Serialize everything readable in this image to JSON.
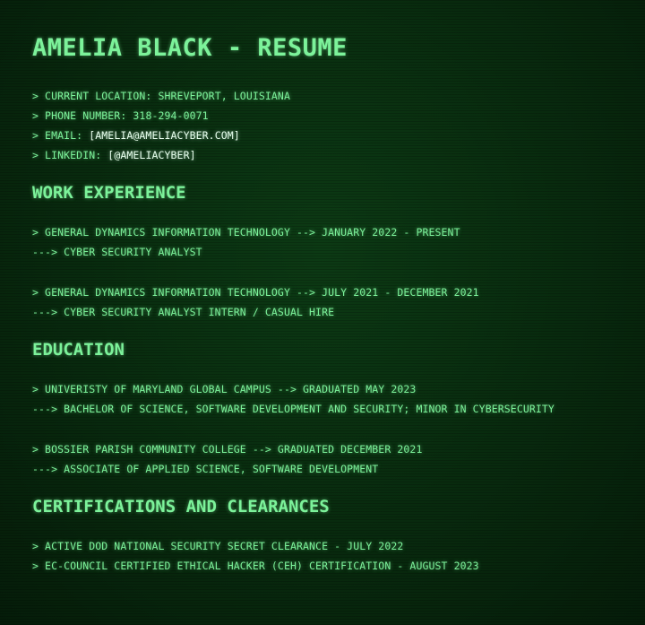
{
  "title": "AMELIA BLACK - RESUME",
  "contact": {
    "location_label": "> CURRENT LOCATION: ",
    "location": "SHREVEPORT, LOUISIANA",
    "phone_label": "> PHONE NUMBER: ",
    "phone": "318-294-0071",
    "email_label": "> EMAIL: ",
    "email": "[AMELIA@AMELIACYBER.COM]",
    "linkedin_label": "> LINKEDIN: ",
    "linkedin": "[@AMELIACYBER]"
  },
  "work": {
    "heading": "WORK EXPERIENCE",
    "entries": [
      {
        "line1": "> GENERAL DYNAMICS INFORMATION TECHNOLOGY --> JANUARY 2022 - PRESENT",
        "line2": "---> CYBER SECURITY ANALYST"
      },
      {
        "line1": "> GENERAL DYNAMICS INFORMATION TECHNOLOGY --> JULY 2021 - DECEMBER 2021",
        "line2": "---> CYBER SECURITY ANALYST INTERN / CASUAL HIRE"
      }
    ]
  },
  "education": {
    "heading": "EDUCATION",
    "entries": [
      {
        "line1": "> UNIVERISTY OF MARYLAND GLOBAL CAMPUS --> GRADUATED MAY 2023",
        "line2": "---> BACHELOR OF SCIENCE, SOFTWARE DEVELOPMENT AND SECURITY; MINOR IN CYBERSECURITY"
      },
      {
        "line1": "> BOSSIER PARISH COMMUNITY COLLEGE --> GRADUATED DECEMBER 2021",
        "line2": "---> ASSOCIATE OF APPLIED SCIENCE, SOFTWARE DEVELOPMENT"
      }
    ]
  },
  "certifications": {
    "heading": "CERTIFICATIONS AND CLEARANCES",
    "items": [
      "> ACTIVE DOD NATIONAL SECURITY SECRET CLEARANCE - JULY 2022",
      "> EC-COUNCIL CERTIFIED ETHICAL HACKER (CEH) CERTIFICATION - AUGUST 2023"
    ]
  },
  "colors": {
    "text": "#7cf29a",
    "link": "#e8ffee",
    "background": "#082a0e"
  }
}
